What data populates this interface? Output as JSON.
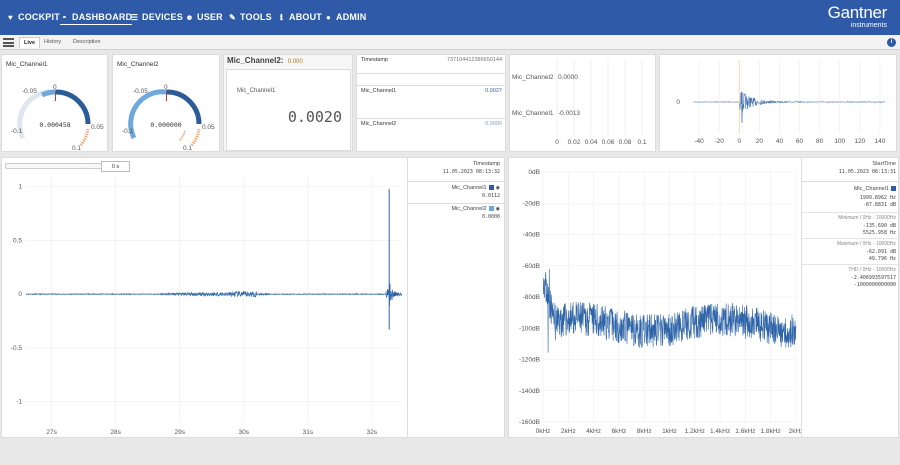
{
  "nav": {
    "items": [
      {
        "label": "COCKPIT",
        "icon": "heart-icon",
        "glyph": "♥"
      },
      {
        "label": "DASHBOARD",
        "icon": "dashboard-gauge-icon",
        "glyph": "◓"
      },
      {
        "label": "DEVICES",
        "icon": "devices-icon",
        "glyph": "☰"
      },
      {
        "label": "USER",
        "icon": "users-icon",
        "glyph": "☻"
      },
      {
        "label": "TOOLS",
        "icon": "wrench-icon",
        "glyph": "✎"
      },
      {
        "label": "ABOUT",
        "icon": "info-icon",
        "glyph": "ℹ"
      },
      {
        "label": "ADMIN",
        "icon": "admin-user-icon",
        "glyph": "●"
      }
    ],
    "logo_brand": "Gantner",
    "logo_sub": "instruments"
  },
  "tabs": [
    "Live",
    "History",
    "Description"
  ],
  "gauges": [
    {
      "title": "Mic_Channel1",
      "value": "0.000458",
      "ticks": [
        "-0.1",
        "-0.05",
        "0",
        "0.05",
        "0.1"
      ]
    },
    {
      "title": "Mic_Channel2",
      "value": "0.000000",
      "ticks": [
        "-0.1",
        "-0.05",
        "0",
        "0.05",
        "0.1"
      ]
    }
  ],
  "value_panel": {
    "header_label": "Mic_Channel2:",
    "header_value": "0.000",
    "label": "Mic_Channel1",
    "value": "0.0020"
  },
  "timestamp_panel": {
    "timestamp_label": "Timestamp",
    "timestamp_value": "737104412386650144",
    "rows": [
      {
        "label": "Mic_Channel1",
        "value": "0.0027"
      },
      {
        "label": "Mic_Channel2",
        "value": "0.0000"
      }
    ]
  },
  "bar_panel": {
    "labels": [
      {
        "name": "Mic_Channel2",
        "value": "0.0000"
      },
      {
        "name": "Mic_Channel1",
        "value": "-0.0013"
      }
    ],
    "x_ticks": [
      "0",
      "0.02",
      "0.04",
      "0.06",
      "0.08",
      "0.1"
    ]
  },
  "small_plot": {
    "y_ticks": [
      "0"
    ],
    "x_ticks": [
      "-40",
      "-20",
      "0",
      "20",
      "40",
      "60",
      "80",
      "100",
      "120",
      "140"
    ]
  },
  "time_plot": {
    "slider_value": "0 s",
    "legend_title": "Timestamp",
    "legend_time": "11.05.2023 08:13:32",
    "legend_rows": [
      {
        "name": "Mic_Channel1",
        "value": "0.0112"
      },
      {
        "name": "Mic_Channel2",
        "value": "0.0000"
      }
    ]
  },
  "fft_plot": {
    "legend_title": "StartTime",
    "legend_time": "11.05.2023 08:13:31",
    "channel": "Mic_Channel1",
    "stats": [
      {
        "label": "",
        "lines": [
          "1999.8962 Hz",
          "-87.8831 dB"
        ]
      },
      {
        "label": "Minimum / 0Hz - 10000Hz",
        "lines": [
          "-135.690 dB",
          "5525.958 Hz"
        ]
      },
      {
        "label": "Maximum / 0Hz - 10000Hz",
        "lines": [
          "-62.091 dB",
          "49.796 Hz"
        ]
      },
      {
        "label": "THD / 0Hz - 10000Hz",
        "lines": [
          "-2.406993597517",
          "-1000000000000"
        ]
      }
    ]
  },
  "chart_data": [
    {
      "type": "line",
      "title": "",
      "x_ticks": [
        "27s",
        "28s",
        "29s",
        "30s",
        "31s",
        "32s"
      ],
      "y_ticks": [
        "1",
        "0.5",
        "0",
        "-0.5",
        "-1"
      ],
      "xlim": [
        26.6,
        32.47
      ],
      "ylim": [
        -1.2,
        1.1
      ],
      "grid": true,
      "series": [
        {
          "name": "Mic_Channel1",
          "color": "#2e64a8",
          "quiet_level": 0.004,
          "burst_level": 0.02,
          "burst_range": [
            28.7,
            30.4
          ],
          "impulse_time": 32.27,
          "impulse_max": 0.98,
          "impulse_min": -0.33
        }
      ]
    },
    {
      "type": "line",
      "title": "",
      "x_ticks": [
        "0kHz",
        "2kHz",
        "4kHz",
        "6kHz",
        "8kHz",
        "1kHz",
        "1.2kHz",
        "1.4kHz",
        "1.6kHz",
        "1.8kHz",
        "2kHz"
      ],
      "y_ticks": [
        "0dB",
        "-20dB",
        "-40dB",
        "-60dB",
        "-80dB",
        "-100dB",
        "-120dB",
        "-140dB",
        "-160dB"
      ],
      "xlim": [
        0,
        2000
      ],
      "ylim": [
        -160,
        0
      ],
      "grid": true,
      "series": [
        {
          "name": "Mic_Channel1",
          "color": "#2e64a8",
          "start_db": -67,
          "mean_db": -98,
          "max_db": -62.091,
          "min_db": -135.69
        }
      ]
    }
  ]
}
